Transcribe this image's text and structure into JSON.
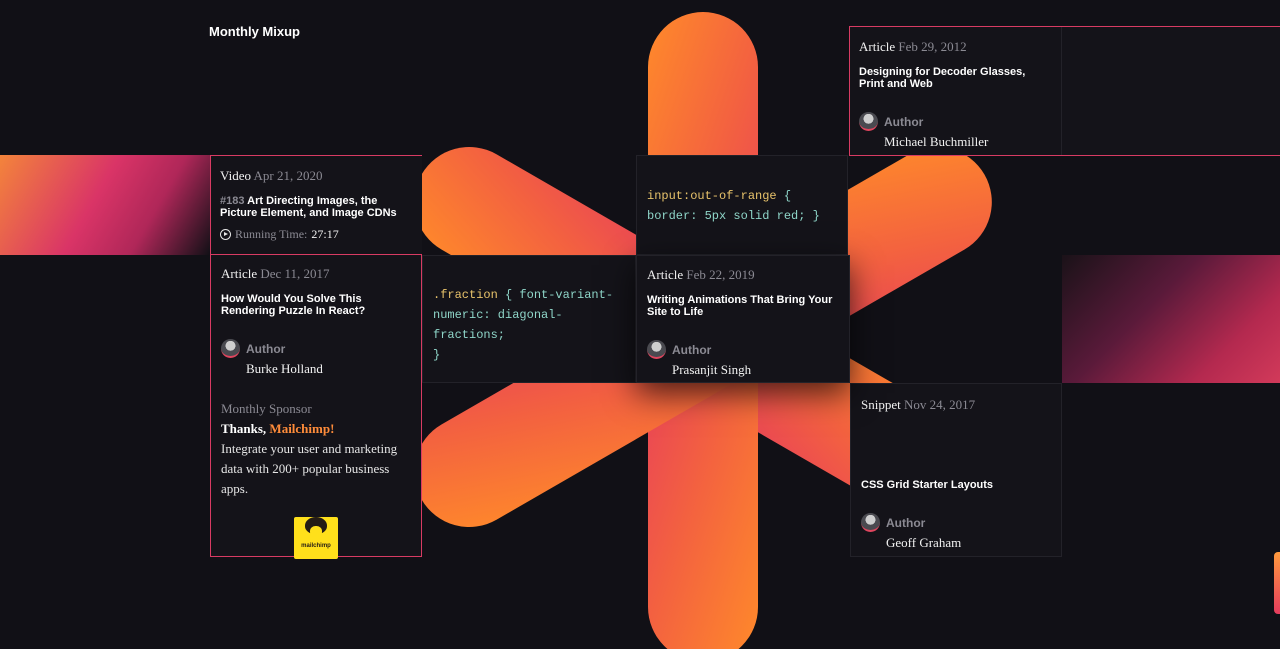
{
  "section_title": "Monthly Mixup",
  "colors": {
    "background": "#111016",
    "accent_pink": "#d83b63",
    "accent_orange": "#ff8c3a"
  },
  "cards": {
    "video": {
      "type": "Video",
      "date": "Apr 21, 2020",
      "number": "#183",
      "title": "Art Directing Images, the Picture Element, and Image CDNs",
      "runtime_label": "Running Time:",
      "runtime_value": "27:17",
      "icon": "play-circle-icon"
    },
    "article_puzzle": {
      "type": "Article",
      "date": "Dec 11, 2017",
      "title": "How Would You Solve This Rendering Puzzle In React?",
      "author_label": "Author",
      "author_name": "Burke Holland"
    },
    "sponsor": {
      "label": "Monthly Sponsor",
      "thanks_prefix": "Thanks, ",
      "brand": "Mailchimp!",
      "text": "Integrate your user and marketing data with 200+ popular business apps.",
      "logo_word": "mailchimp"
    },
    "code_fraction": {
      "selector": ".fraction",
      "open": " { ",
      "declaration": "font-variant-numeric: diagonal-fractions;",
      "close": "}"
    },
    "code_range": {
      "selector": "input:out-of-range",
      "open": " { ",
      "declaration": "border: 5px solid red;",
      "close": " }"
    },
    "article_decoder": {
      "type": "Article",
      "date": "Feb 29, 2012",
      "title": "Designing for Decoder Glasses, Print and Web",
      "author_label": "Author",
      "author_name": "Michael Buchmiller"
    },
    "article_animations": {
      "type": "Article",
      "date": "Feb 22, 2019",
      "title": "Writing Animations That Bring Your Site to Life",
      "author_label": "Author",
      "author_name": "Prasanjit Singh"
    },
    "snippet_grid": {
      "type": "Snippet",
      "date": "Nov 24, 2017",
      "title": "CSS Grid Starter Layouts",
      "author_label": "Author",
      "author_name": "Geoff Graham"
    }
  }
}
